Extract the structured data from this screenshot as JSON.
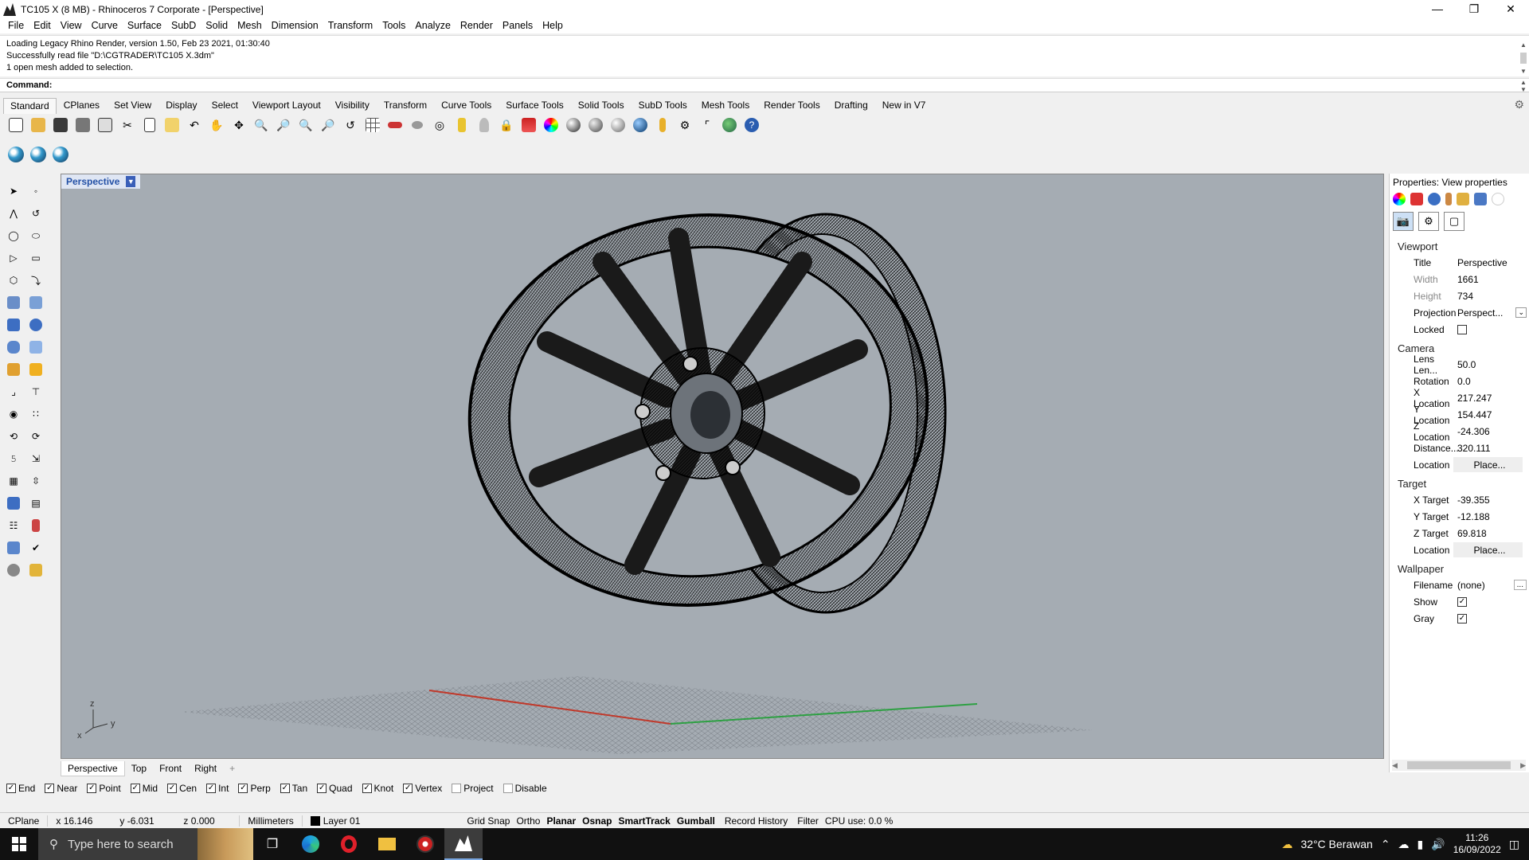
{
  "window": {
    "title": "TC105 X (8 MB) - Rhinoceros 7 Corporate - [Perspective]"
  },
  "menu": [
    "File",
    "Edit",
    "View",
    "Curve",
    "Surface",
    "SubD",
    "Solid",
    "Mesh",
    "Dimension",
    "Transform",
    "Tools",
    "Analyze",
    "Render",
    "Panels",
    "Help"
  ],
  "history": [
    "Loading Legacy Rhino Render, version 1.50, Feb 23 2021, 01:30:40",
    "Successfully read file \"D:\\CGTRADER\\TC105 X.3dm\"",
    "1 open mesh added to selection."
  ],
  "command": {
    "label": "Command:",
    "value": ""
  },
  "tabs": [
    "Standard",
    "CPlanes",
    "Set View",
    "Display",
    "Select",
    "Viewport Layout",
    "Visibility",
    "Transform",
    "Curve Tools",
    "Surface Tools",
    "Solid Tools",
    "SubD Tools",
    "Mesh Tools",
    "Render Tools",
    "Drafting",
    "New in V7"
  ],
  "viewport": {
    "label": "Perspective",
    "bg": "#a5acb3",
    "axes": {
      "x": "x",
      "y": "y",
      "z": "z"
    }
  },
  "viewport_tabs": [
    "Perspective",
    "Top",
    "Front",
    "Right",
    "+"
  ],
  "osnaps": [
    {
      "label": "End",
      "checked": true
    },
    {
      "label": "Near",
      "checked": true
    },
    {
      "label": "Point",
      "checked": true
    },
    {
      "label": "Mid",
      "checked": true
    },
    {
      "label": "Cen",
      "checked": true
    },
    {
      "label": "Int",
      "checked": true
    },
    {
      "label": "Perp",
      "checked": true
    },
    {
      "label": "Tan",
      "checked": true
    },
    {
      "label": "Quad",
      "checked": true
    },
    {
      "label": "Knot",
      "checked": true
    },
    {
      "label": "Vertex",
      "checked": true
    },
    {
      "label": "Project",
      "checked": false
    },
    {
      "label": "Disable",
      "checked": false
    }
  ],
  "status": {
    "cplane": "CPlane",
    "x": "x 16.146",
    "y": "y -6.031",
    "z": "z 0.000",
    "units": "Millimeters",
    "layer": "Layer 01",
    "grid_snap": "Grid Snap",
    "ortho": "Ortho",
    "planar": "Planar",
    "osnap": "Osnap",
    "smarttrack": "SmartTrack",
    "gumball": "Gumball",
    "record_history": "Record History",
    "filter": "Filter",
    "cpu": "CPU use: 0.0 %"
  },
  "panel": {
    "title": "Properties: View properties",
    "viewport_header": "Viewport",
    "viewport": {
      "title_label": "Title",
      "title_value": "Perspective",
      "width_label": "Width",
      "width_value": "1661",
      "height_label": "Height",
      "height_value": "734",
      "projection_label": "Projection",
      "projection_value": "Perspect...",
      "locked_label": "Locked"
    },
    "camera_header": "Camera",
    "camera": {
      "lens_label": "Lens Len...",
      "lens_value": "50.0",
      "rotation_label": "Rotation",
      "rotation_value": "0.0",
      "xloc_label": "X Location",
      "xloc_value": "217.247",
      "yloc_label": "Y Location",
      "yloc_value": "154.447",
      "zloc_label": "Z Location",
      "zloc_value": "-24.306",
      "dist_label": "Distance...",
      "dist_value": "320.111",
      "loc_label": "Location",
      "loc_button": "Place..."
    },
    "target_header": "Target",
    "target": {
      "x_label": "X Target",
      "x_value": "-39.355",
      "y_label": "Y Target",
      "y_value": "-12.188",
      "z_label": "Z Target",
      "z_value": "69.818",
      "loc_label": "Location",
      "loc_button": "Place..."
    },
    "wallpaper_header": "Wallpaper",
    "wallpaper": {
      "filename_label": "Filename",
      "filename_value": "(none)",
      "browse": "...",
      "show_label": "Show",
      "gray_label": "Gray"
    }
  },
  "taskbar": {
    "search_placeholder": "Type here to search",
    "weather": "32°C  Berawan",
    "time": "11:26",
    "date": "16/09/2022"
  }
}
